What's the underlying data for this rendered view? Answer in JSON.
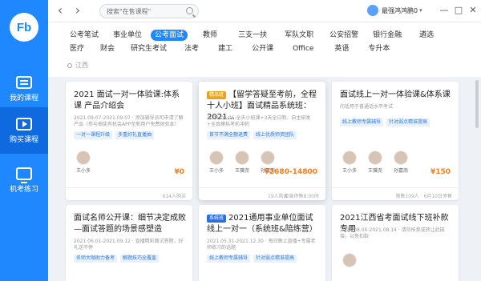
{
  "sidebar": {
    "logo": "Fb",
    "items": [
      {
        "label": "我的课程",
        "icon": "book-icon"
      },
      {
        "label": "购买课程",
        "icon": "play-icon"
      },
      {
        "label": "机考练习",
        "icon": "monitor-icon"
      }
    ]
  },
  "topbar": {
    "search_placeholder": "搜索\"在售课程\"",
    "user_name": "最强鸿鸿鹏0",
    "controls": [
      "—",
      "□",
      "✕"
    ]
  },
  "filters": {
    "row1": [
      "公考笔试",
      "事业单位",
      "公考面试",
      "教师",
      "三支一扶",
      "军队文职",
      "公安招警",
      "银行金融",
      "遴选"
    ],
    "row2": [
      "医疗",
      "财会",
      "研究生考试",
      "法考",
      "建工",
      "公开课",
      "Office",
      "英语",
      "专升本"
    ],
    "active": "公考面试",
    "location": "江西"
  },
  "cards": [
    {
      "title": "2021 面试一对一体验课:体系课 产品介绍会",
      "subtitle": "2021.09.07-2021.09.07 · 添加辅导员可申请了解产品（参与抽奖有机会APP至新用户免费体验本）",
      "chips": [
        "一对一课程升级",
        "多重好礼直播抽"
      ],
      "teachers": [
        "王小多"
      ],
      "price": "¥0",
      "footer_left": "",
      "footer_right": "614人购买"
    },
    {
      "badge": "精品班",
      "title": "【留学答疑至考前，全程十人小班】面试精品系统班：2021...",
      "subtitle": "2021.08.06-全天小班课+3天全日制，自主研发+全真模拟考前冲刺",
      "chips": [
        "首节不满全额退费",
        "线上优质师资团队"
      ],
      "teachers": [
        "王小多",
        "王骥尧",
        "孙嘉南"
      ],
      "price": "¥2680-14800",
      "footer_left": "19人购买",
      "footer_right": "距离停售8:00时"
    },
    {
      "title": "面试线上一对一体验课&体系课",
      "subtitle": "问适用于普通话水平考试",
      "chips": [
        "线上教师专属辅导",
        "针对弱点精准提高"
      ],
      "teachers": [
        "王小多",
        "王骥尧",
        "孙嘉南"
      ],
      "price": "¥150",
      "footer_left": "",
      "footer_right": "限售109人 · 6月10日停售"
    },
    {
      "title": "面试名师公开课：细节决定成败—面试答题的场景感塑造",
      "subtitle": "2021.06.01-2021.09.12 · 直播精彩面试答题，好礼送不停",
      "chips": [
        "名师大咖助力备考",
        "解题技巧全覆盖"
      ]
    },
    {
      "badge": "系统班",
      "badge_style": "blue",
      "title": "2021通用事业单位面试线上一对一（系统班&陪练营）",
      "subtitle": "2021.05.31-2021.12.30 · 每日晚上直播+专属老师练习的话题",
      "chips": [
        "线上教师专属辅导",
        "针对弱点精准提高"
      ]
    },
    {
      "title": "2021江西省考面试线下班补款专用",
      "subtitle": "2021.08.05-2021.08.14 · 请勿拍卖或转让此链接，以免扣款",
      "chips": []
    }
  ],
  "colors": {
    "accent": "#1f88ff",
    "price": "#ff7d1a"
  }
}
